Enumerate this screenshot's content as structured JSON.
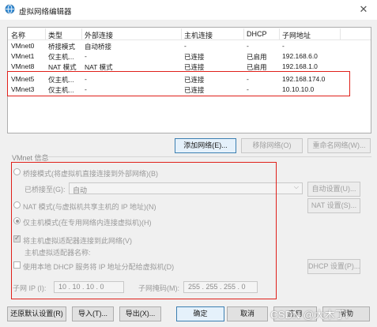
{
  "window": {
    "title": "虚拟网络编辑器"
  },
  "table": {
    "headers": [
      "名称",
      "类型",
      "外部连接",
      "主机连接",
      "DHCP",
      "子网地址"
    ],
    "rows": [
      [
        "VMnet0",
        "桥接模式",
        "自动桥接",
        "-",
        "-",
        "-"
      ],
      [
        "VMnet1",
        "仅主机...",
        "-",
        "已连接",
        "已启用",
        "192.168.6.0"
      ],
      [
        "VMnet8",
        "NAT 模式",
        "NAT 模式",
        "已连接",
        "已启用",
        "192.168.1.0"
      ],
      [
        "VMnet5",
        "仅主机...",
        "-",
        "已连接",
        "-",
        "192.168.174.0"
      ],
      [
        "VMnet3",
        "仅主机...",
        "-",
        "已连接",
        "-",
        "10.10.10.0"
      ]
    ]
  },
  "table_buttons": {
    "add": "添加网络(E)...",
    "remove": "移除网络(O)",
    "rename": "重命名网络(W)..."
  },
  "info": {
    "group_label": "VMnet 信息",
    "bridged_label": "桥接模式(将虚拟机直接连接到外部网络)(B)",
    "bridged_to_label": "已桥接至(G):",
    "bridged_to_value": "自动",
    "auto_settings": "自动设置(U)...",
    "nat_label": "NAT 模式(与虚拟机共享主机的 IP 地址)(N)",
    "nat_settings": "NAT 设置(S)...",
    "hostonly_label": "仅主机模式(在专用网络内连接虚拟机)(H)",
    "connect_adapter_label": "将主机虚拟适配器连接到此网络(V)",
    "adapter_name_label": "主机虚拟适配器名称:",
    "dhcp_label": "使用本地 DHCP 服务将 IP 地址分配给虚拟机(D)",
    "dhcp_settings": "DHCP 设置(P)...",
    "subnet_ip_label": "子网 IP (I):",
    "subnet_ip_value": "10 . 10 . 10 . 0",
    "subnet_mask_label": "子网掩码(M):",
    "subnet_mask_value": "255 . 255 . 255 . 0"
  },
  "footer": {
    "restore": "还原默认设置(R)",
    "import": "导入(T)...",
    "export": "导出(X)...",
    "ok": "确定",
    "cancel": "取消",
    "apply": "应用",
    "help": "帮助"
  },
  "watermark": "CSDN @大木丁i",
  "colors": {
    "annotation": "#e0201a",
    "window_bg": "#f0f0f0",
    "default_button_border": "#3c7fb1"
  }
}
